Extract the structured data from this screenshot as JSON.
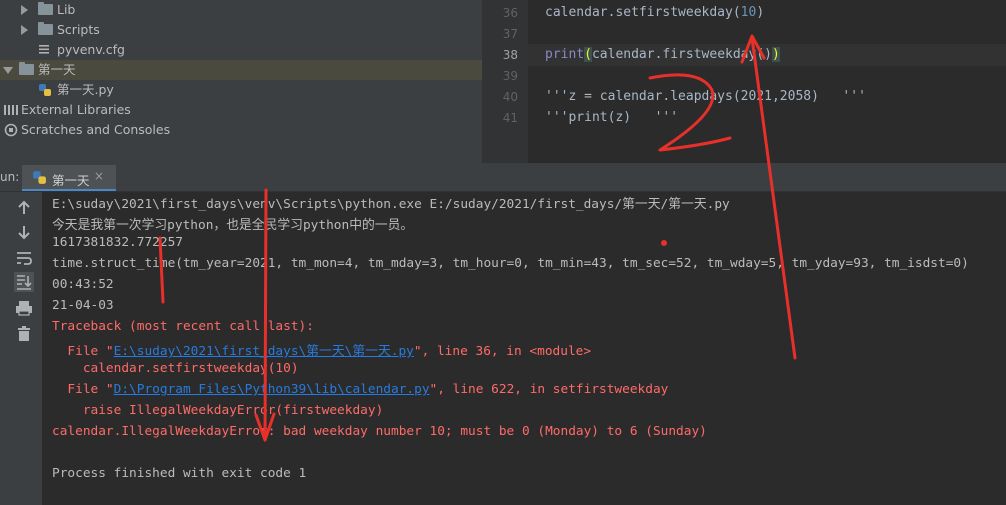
{
  "tree": {
    "items": [
      {
        "label": "Lib",
        "type": "folder",
        "state": "collapsed"
      },
      {
        "label": "Scripts",
        "type": "folder",
        "state": "collapsed"
      },
      {
        "label": "pyvenv.cfg",
        "type": "config-file"
      },
      {
        "label": "第一天",
        "type": "folder",
        "state": "expanded"
      },
      {
        "label": "第一天.py",
        "type": "python-file"
      },
      {
        "label": "External Libraries",
        "type": "libraries"
      },
      {
        "label": "Scratches and Consoles",
        "type": "scratches"
      }
    ]
  },
  "editor": {
    "line_numbers": [
      "36",
      "37",
      "38",
      "39",
      "40",
      "41"
    ],
    "line36": {
      "pre": "calendar.setfirstweekday(",
      "num": "10",
      "post": ")"
    },
    "line38": {
      "kw": "print",
      "open": "(",
      "mid": "calendar.firstweekday()",
      "close": ")"
    },
    "line40": "'''z = calendar.leapdays(2021,2058)   '''",
    "line41": "'''print(z)   '''"
  },
  "run": {
    "label": "un:",
    "tab_label": "第一天",
    "close": "×"
  },
  "console": {
    "cmd": "E:\\suday\\2021\\first_days\\venv\\Scripts\\python.exe E:/suday/2021/first_days/第一天/第一天.py",
    "out1": "今天是我第一次学习python，也是全民学习python中的一员。",
    "out2": "1617381832.772257",
    "out3": "time.struct_time(tm_year=2021, tm_mon=4, tm_mday=3, tm_hour=0, tm_min=43, tm_sec=52, tm_wday=5, tm_yday=93, tm_isdst=0)",
    "out4": "00:43:52",
    "out5": "21-04-03",
    "tb_header": "Traceback (most recent call last):",
    "tb1_pre": "  File \"",
    "tb1_link": "E:\\suday\\2021\\first_days\\第一天\\第一天.py",
    "tb1_post": "\", line 36, in <module>",
    "tb1_code": "    calendar.setfirstweekday(10)",
    "tb2_pre": "  File \"",
    "tb2_link": "D:\\Program Files\\Python39\\lib\\calendar.py",
    "tb2_post": "\", line 622, in setfirstweekday",
    "tb2_code": "    raise IllegalWeekdayError(firstweekday)",
    "error": "calendar.IllegalWeekdayError: bad weekday number 10; must be 0 (Monday) to 6 (Sunday)",
    "finished": "Process finished with exit code 1"
  },
  "colors": {
    "error_red": "#ff6b68",
    "link_blue": "#287bde",
    "annotation_red": "#e8302a"
  }
}
